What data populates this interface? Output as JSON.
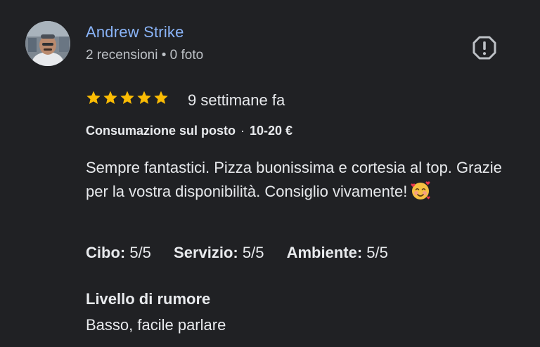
{
  "author": {
    "name": "Andrew Strike",
    "reviews_count": "2 recensioni",
    "separator": "•",
    "photos_count": "0 foto"
  },
  "report": {
    "icon": "report-flag-icon"
  },
  "rating": {
    "stars": 5,
    "max_stars": 5,
    "star_color": "#fbbc04",
    "date": "9 settimane fa"
  },
  "service": {
    "type": "Consumazione sul posto",
    "dot": "·",
    "price": "10-20 €"
  },
  "review": {
    "text": "Sempre fantastici. Pizza buonissima e cortesia al top. Grazie per la vostra disponibilità. Consiglio vivamente!",
    "emoji": "smiling-face-with-hearts-icon"
  },
  "sub_ratings": [
    {
      "label": "Cibo:",
      "value": "5/5"
    },
    {
      "label": "Servizio:",
      "value": "5/5"
    },
    {
      "label": "Ambiente:",
      "value": "5/5"
    }
  ],
  "noise": {
    "label": "Livello di rumore",
    "value": "Basso, facile parlare"
  },
  "colors": {
    "background": "#202124",
    "author_link": "#8ab4f8",
    "secondary_text": "#bdc1c6"
  }
}
